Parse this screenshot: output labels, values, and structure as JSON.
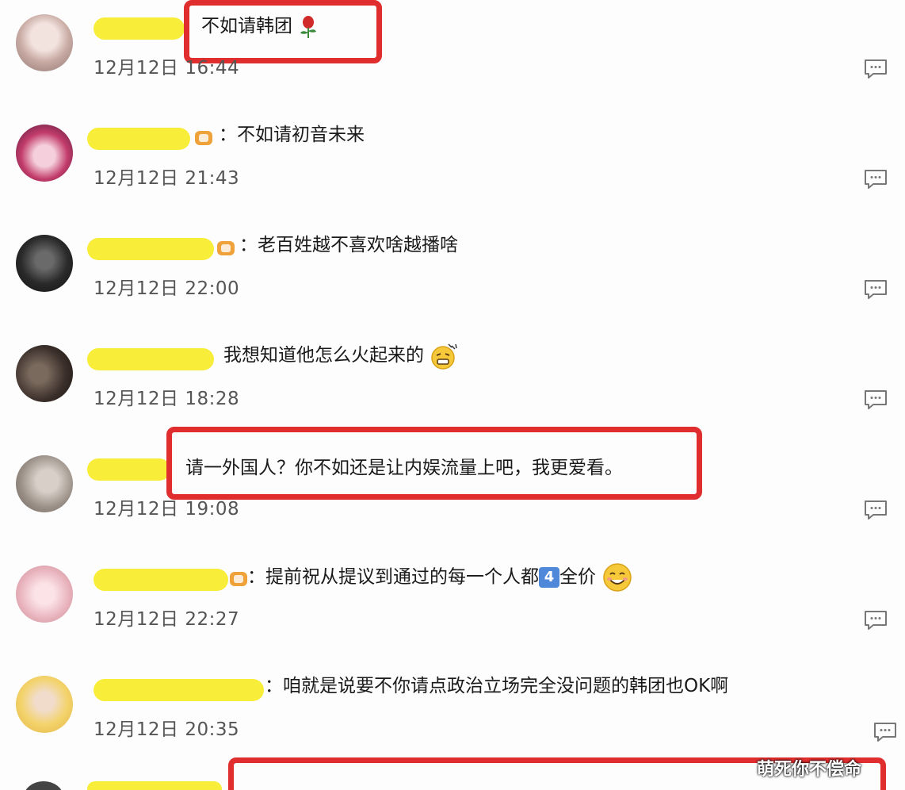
{
  "comments": [
    {
      "text": "不如请韩团",
      "time": "12月12日 16:44",
      "avatar_color": "#d8c6c4",
      "highlighted": true,
      "emoji": "rose-icon"
    },
    {
      "text": "不如请初音未来",
      "time": "12月12日 21:43",
      "avatar_color": "#b8426a",
      "highlighted": false
    },
    {
      "text": "老百姓越不喜欢啥越播啥",
      "time": "12月12日 22:00",
      "avatar_color": "#2a2a2a",
      "highlighted": false
    },
    {
      "text": "我想知道他怎么火起来的",
      "time": "12月12日 18:28",
      "avatar_color": "#3b2f2a",
      "highlighted": false,
      "emoji": "grimace-emoji"
    },
    {
      "text": "请一外国人？你不如还是让内娱流量上吧，我更爱看。",
      "time": "12月12日 19:08",
      "avatar_color": "#9a8f86",
      "highlighted": true
    },
    {
      "text_before": "提前祝从提议到通过的每一个人都",
      "badge": "4",
      "text_after": "全价",
      "time": "12月12日 22:27",
      "avatar_color": "#e9b4bd",
      "highlighted": false,
      "emoji": "smile-emoji"
    },
    {
      "text": "咱就是说要不你请点政治立场完全没问题的韩团也OK啊",
      "time": "12月12日 20:35",
      "avatar_color": "#f3d36a",
      "highlighted": false
    }
  ],
  "watermark": "萌死你不偿命",
  "colors": {
    "highlight": "#e02d2d",
    "name_blur": "#f8ee3a",
    "vip_badge": "#f0a23a"
  }
}
